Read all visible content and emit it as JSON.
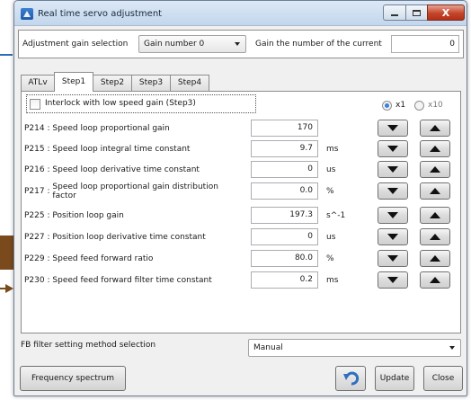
{
  "window": {
    "title": "Real time servo adjustment",
    "controls": {
      "close_glyph": "X"
    }
  },
  "gain": {
    "selection_label": "Adjustment gain selection",
    "selection_value": "Gain number 0",
    "current_label": "Gain the number of the current",
    "current_value": "0"
  },
  "tabs": [
    {
      "label": "ATLv"
    },
    {
      "label": "Step1",
      "active": true
    },
    {
      "label": "Step2"
    },
    {
      "label": "Step3"
    },
    {
      "label": "Step4"
    }
  ],
  "interlock": {
    "label": "Interlock with low speed gain (Step3)",
    "checked": false
  },
  "multiplier": {
    "options": [
      "x1",
      "x10"
    ],
    "selected": "x1"
  },
  "params": [
    {
      "code": "P214",
      "name": "Speed loop proportional gain",
      "value": "170",
      "unit": ""
    },
    {
      "code": "P215",
      "name": "Speed loop integral time constant",
      "value": "9.7",
      "unit": "ms"
    },
    {
      "code": "P216",
      "name": "Speed loop derivative time constant",
      "value": "0",
      "unit": "us"
    },
    {
      "code": "P217",
      "name_line1": "Speed loop proportional gain distribution",
      "name_line2": "factor",
      "value": "0.0",
      "unit": "%"
    },
    {
      "code": "P225",
      "name": "Position loop gain",
      "value": "197.3",
      "unit": "s^-1"
    },
    {
      "code": "P227",
      "name": "Position loop derivative time constant",
      "value": "0",
      "unit": "us"
    },
    {
      "code": "P229",
      "name": "Speed feed forward ratio",
      "value": "80.0",
      "unit": "%"
    },
    {
      "code": "P230",
      "name": "Speed feed forward filter time constant",
      "value": "0.2",
      "unit": "ms"
    }
  ],
  "separator": ":",
  "fb_filter": {
    "label": "FB filter setting method selection",
    "value": "Manual"
  },
  "buttons": {
    "frequency_spectrum": "Frequency spectrum",
    "update": "Update",
    "close": "Close"
  },
  "icons": {
    "app": "app-icon",
    "undo": "undo-icon",
    "decrement": "down-triangle-icon",
    "increment": "up-triangle-icon"
  },
  "colors": {
    "accent": "#3c7fd6",
    "close_button": "#c4452a",
    "undo_arrow": "#2f6fbf"
  }
}
